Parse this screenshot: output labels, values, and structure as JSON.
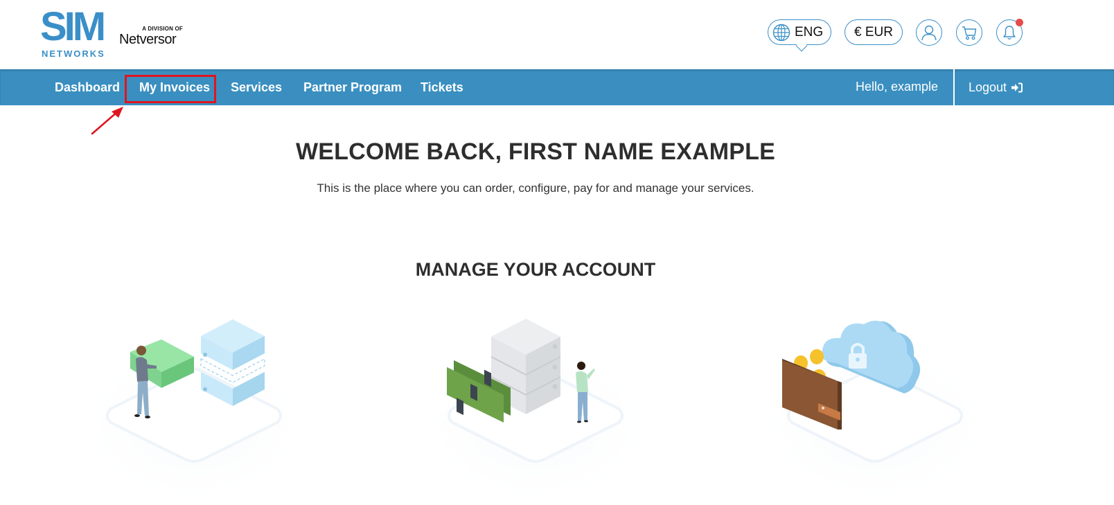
{
  "header": {
    "logo": {
      "main": "SIM",
      "sub": "NETWORKS",
      "division_label": "A DIVISION OF",
      "division_brand": "Netversor"
    },
    "language": {
      "label": "ENG",
      "icon": "globe-icon"
    },
    "currency": {
      "label": "€ EUR"
    },
    "icons": {
      "account": "user-icon",
      "cart": "cart-icon",
      "notifications": "bell-icon"
    },
    "notification_badge_color": "#e64b4b"
  },
  "nav": {
    "items": [
      {
        "label": "Dashboard"
      },
      {
        "label": "My Invoices",
        "highlighted": true
      },
      {
        "label": "Services"
      },
      {
        "label": "Partner Program"
      },
      {
        "label": "Tickets"
      }
    ],
    "greeting": "Hello, example",
    "logout": "Logout",
    "background_color": "#3a8fc0",
    "highlight_color": "#e0141e"
  },
  "main": {
    "welcome": "WELCOME BACK, FIRST NAME EXAMPLE",
    "subtitle": "This is the place where you can order, configure, pay for and manage your services.",
    "section_title": "MANAGE YOUR ACCOUNT",
    "cards": [
      {
        "illustration": "server-migration-illustration"
      },
      {
        "illustration": "server-memory-illustration"
      },
      {
        "illustration": "wallet-cloud-billing-illustration"
      }
    ]
  }
}
